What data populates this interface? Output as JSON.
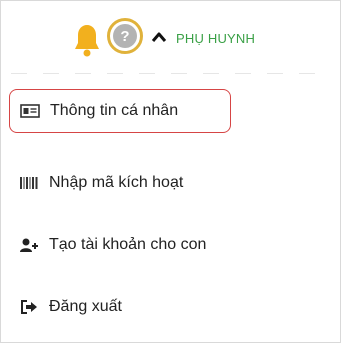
{
  "header": {
    "role_label": "PHỤ HUYNH",
    "icons": [
      "bell-icon",
      "help-icon",
      "chevron-up-icon"
    ],
    "accent_color": "#3aa046",
    "highlight_ring_color": "#e0b23b",
    "help_label": "?"
  },
  "menu": {
    "items": [
      {
        "label": "Thông tin cá nhân",
        "icon": "id-card-icon",
        "highlighted": true
      },
      {
        "label": "Nhập mã kích hoạt",
        "icon": "barcode-icon"
      },
      {
        "label": "Tạo tài khoản cho con",
        "icon": "add-user-icon"
      },
      {
        "label": "Đăng xuất",
        "icon": "logout-icon"
      }
    ],
    "highlight_color": "#d64545"
  }
}
